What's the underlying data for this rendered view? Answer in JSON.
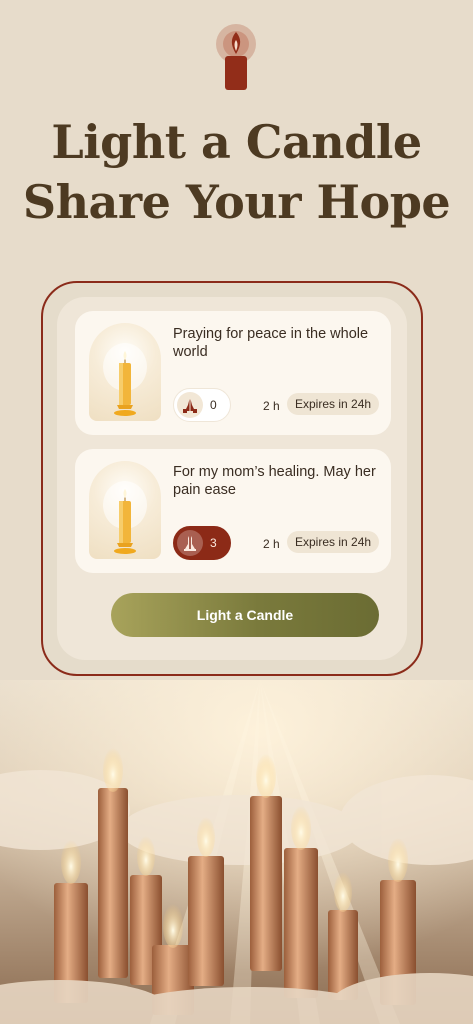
{
  "header": {
    "title_line1": "Light a Candle",
    "title_line2": "Share Your Hope"
  },
  "icons": {
    "logo": "candle-flame-icon",
    "reaction": "praying-hands-icon"
  },
  "colors": {
    "background": "#e7dccb",
    "accent": "#8b2b1a",
    "title": "#4d3a22",
    "button_start": "#a8a35b",
    "button_end": "#6b6c33"
  },
  "prayers": [
    {
      "text": "Praying for peace in the whole world",
      "reaction_count": "0",
      "reacted": false,
      "age": "2 h",
      "expires": "Expires in 24h"
    },
    {
      "text": "For my mom’s healing. May her pain ease",
      "reaction_count": "3",
      "reacted": true,
      "age": "2 h",
      "expires": "Expires in 24h"
    }
  ],
  "actions": {
    "light_candle": "Light a Candle"
  }
}
